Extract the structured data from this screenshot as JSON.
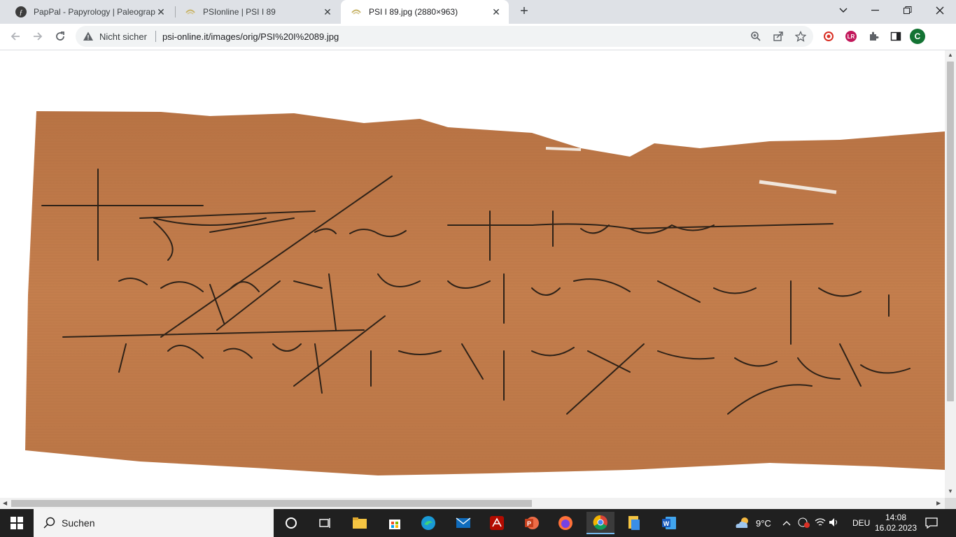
{
  "tabs": [
    {
      "title": "PapPal - Papyrology | Paleograph",
      "icon": "pappal-icon",
      "active": false
    },
    {
      "title": "PSIonline | PSI I 89",
      "icon": "psi-icon",
      "active": false
    },
    {
      "title": "PSI I 89.jpg (2880×963)",
      "icon": "psi-icon",
      "active": true
    }
  ],
  "omnibox": {
    "security_label": "Nicht sicher",
    "url": "psi-online.it/images/orig/PSI%20I%2089.jpg"
  },
  "profile": {
    "initial": "C",
    "color": "#137333"
  },
  "papyrus": {
    "color": "#c07a48"
  },
  "taskbar": {
    "search_label": "Suchen",
    "weather_temp": "9°C",
    "language": "DEU",
    "time": "14:08",
    "date": "16.02.2023"
  }
}
